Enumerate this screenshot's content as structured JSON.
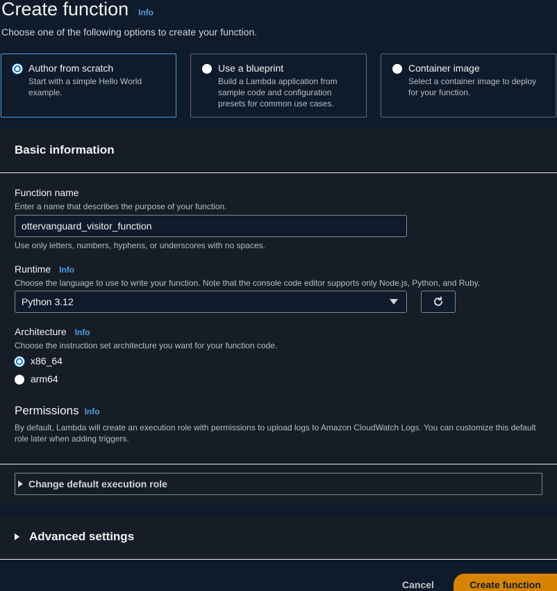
{
  "header": {
    "title": "Create function",
    "info": "Info",
    "subtitle": "Choose one of the following options to create your function."
  },
  "options": [
    {
      "title": "Author from scratch",
      "desc": "Start with a simple Hello World example.",
      "selected": true
    },
    {
      "title": "Use a blueprint",
      "desc": "Build a Lambda application from sample code and configuration presets for common use cases.",
      "selected": false
    },
    {
      "title": "Container image",
      "desc": "Select a container image to deploy for your function.",
      "selected": false
    }
  ],
  "basic": {
    "heading": "Basic information",
    "function_name": {
      "label": "Function name",
      "desc": "Enter a name that describes the purpose of your function.",
      "value": "ottervanguard_visitor_function",
      "hint": "Use only letters, numbers, hyphens, or underscores with no spaces."
    },
    "runtime": {
      "label": "Runtime",
      "info": "Info",
      "desc": "Choose the language to use to write your function. Note that the console code editor supports only Node.js, Python, and Ruby.",
      "value": "Python 3.12"
    },
    "architecture": {
      "label": "Architecture",
      "info": "Info",
      "desc": "Choose the instruction set architecture you want for your function code.",
      "options": [
        {
          "label": "x86_64",
          "selected": true
        },
        {
          "label": "arm64",
          "selected": false
        }
      ]
    },
    "permissions": {
      "label": "Permissions",
      "info": "Info",
      "desc": "By default, Lambda will create an execution role with permissions to upload logs to Amazon CloudWatch Logs. You can customize this default role later when adding triggers."
    },
    "expander_label": "Change default execution role"
  },
  "advanced": {
    "label": "Advanced settings"
  },
  "footer": {
    "cancel": "Cancel",
    "create": "Create function"
  },
  "colors": {
    "accent": "#539fe5",
    "primary_button": "#d88300",
    "background": "#0f1b2a"
  }
}
